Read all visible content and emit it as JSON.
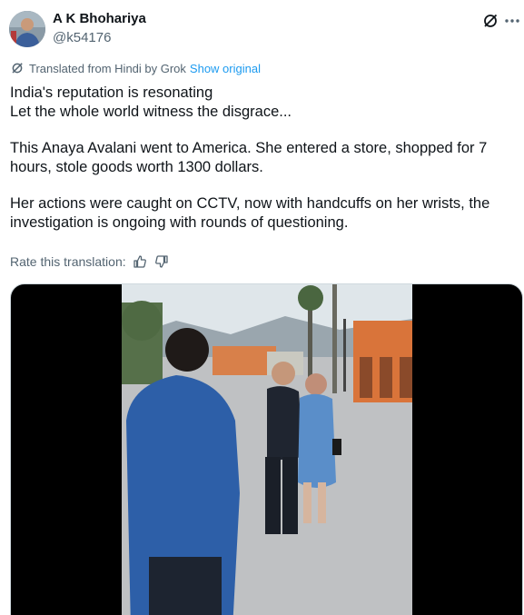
{
  "author": {
    "display_name": "A K Bhohariya",
    "handle": "@k54176"
  },
  "icons": {
    "avatar": "avatar-photo",
    "grok": "grok-slash-icon",
    "translate": "grok-slash-icon",
    "thumbs_up": "thumbs-up-icon",
    "thumbs_down": "thumbs-down-icon"
  },
  "translation": {
    "label": "Translated from Hindi by Grok",
    "show_original": "Show original"
  },
  "post": {
    "paragraphs": [
      [
        "India's reputation is resonating",
        "Let the whole world witness the disgrace..."
      ],
      [
        "This Anaya Avalani went to America. She entered a store, shopped for 7",
        "hours, stole goods worth 1300 dollars."
      ],
      [
        "Her actions were caught on CCTV, now with handcuffs on her wrists, the",
        "investigation is ongoing with rounds of questioning."
      ]
    ]
  },
  "rating": {
    "label": "Rate this translation:"
  },
  "colors": {
    "accent": "#1d9bf0",
    "secondary_text": "#536471",
    "primary_text": "#0f1419"
  }
}
